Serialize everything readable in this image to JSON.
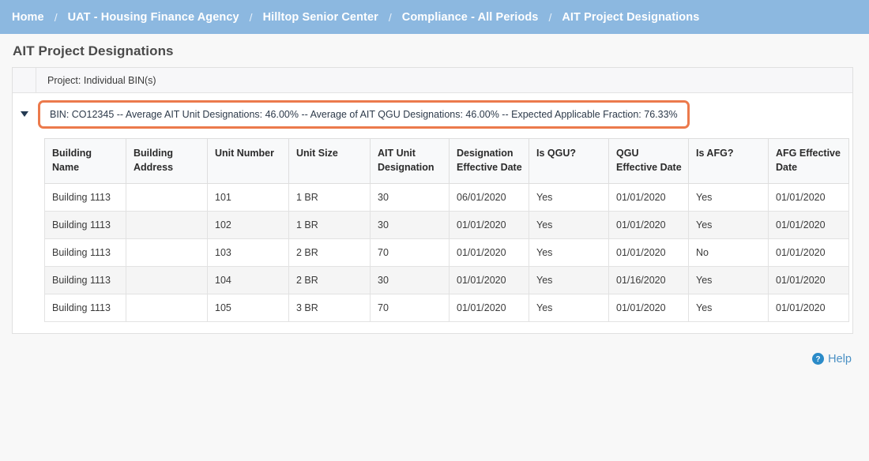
{
  "breadcrumb": {
    "separator": "/",
    "items": [
      {
        "label": "Home"
      },
      {
        "label": "UAT - Housing Finance Agency"
      },
      {
        "label": "Hilltop Senior Center"
      },
      {
        "label": "Compliance - All Periods"
      },
      {
        "label": "AIT Project Designations"
      }
    ]
  },
  "page": {
    "title": "AIT Project Designations"
  },
  "panel": {
    "project_label": "Project: Individual BIN(s)",
    "bin_summary": "BIN: CO12345 -- Average AIT Unit Designations: 46.00% -- Average of AIT QGU Designations: 46.00% -- Expected Applicable Fraction: 76.33%",
    "highlight_color": "#ec7a4c",
    "caret_state": "expanded"
  },
  "table": {
    "headers": [
      "Building Name",
      "Building Address",
      "Unit Number",
      "Unit Size",
      "AIT Unit Designation",
      "Designation Effective Date",
      "Is QGU?",
      "QGU Effective Date",
      "Is AFG?",
      "AFG Effective Date"
    ],
    "rows": [
      [
        "Building 1113",
        "",
        "101",
        "1 BR",
        "30",
        "06/01/2020",
        "Yes",
        "01/01/2020",
        "Yes",
        "01/01/2020"
      ],
      [
        "Building 1113",
        "",
        "102",
        "1 BR",
        "30",
        "01/01/2020",
        "Yes",
        "01/01/2020",
        "Yes",
        "01/01/2020"
      ],
      [
        "Building 1113",
        "",
        "103",
        "2 BR",
        "70",
        "01/01/2020",
        "Yes",
        "01/01/2020",
        "No",
        "01/01/2020"
      ],
      [
        "Building 1113",
        "",
        "104",
        "2 BR",
        "30",
        "01/01/2020",
        "Yes",
        "01/16/2020",
        "Yes",
        "01/01/2020"
      ],
      [
        "Building 1113",
        "",
        "105",
        "3 BR",
        "70",
        "01/01/2020",
        "Yes",
        "01/01/2020",
        "Yes",
        "01/01/2020"
      ]
    ]
  },
  "footer": {
    "help_label": "Help",
    "help_icon": "question-circle-icon",
    "help_color": "#4a90c4"
  }
}
